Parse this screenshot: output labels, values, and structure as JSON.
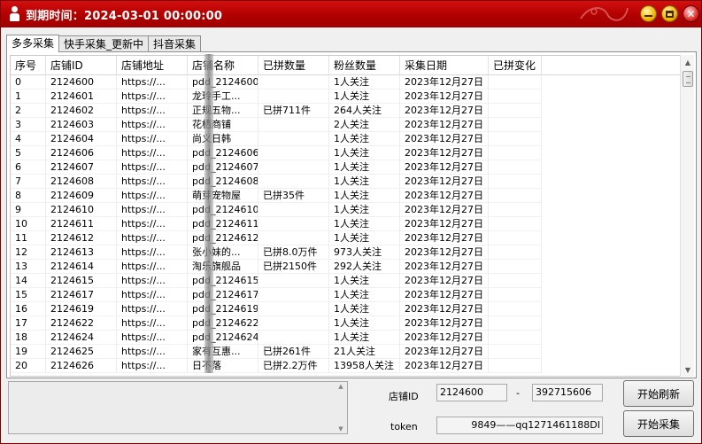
{
  "window": {
    "title": "到期时间：2024-03-01 00:00:00",
    "accent": "#b00000"
  },
  "tabs": [
    {
      "label": "多多采集",
      "active": true
    },
    {
      "label": "快手采集_更新中",
      "active": false
    },
    {
      "label": "抖音采集",
      "active": false
    }
  ],
  "table": {
    "columns": [
      "序号",
      "店铺ID",
      "店铺地址",
      "店铺名称",
      "已拼数量",
      "粉丝数量",
      "采集日期",
      "已拼变化"
    ],
    "rows": [
      [
        "0",
        "2124600",
        "https://...",
        "pdd_2124600",
        "",
        "1人关注",
        "2023年12月27日",
        ""
      ],
      [
        "1",
        "2124601",
        "https://...",
        "龙玲手工...",
        "",
        "1人关注",
        "2023年12月27日",
        ""
      ],
      [
        "2",
        "2124602",
        "https://...",
        "正规五物...",
        "已拼711件",
        "264人关注",
        "2023年12月27日",
        ""
      ],
      [
        "3",
        "2124603",
        "https://...",
        "花栖商铺",
        "",
        "2人关注",
        "2023年12月27日",
        ""
      ],
      [
        "4",
        "2124604",
        "https://...",
        "尚义日韩",
        "",
        "1人关注",
        "2023年12月27日",
        ""
      ],
      [
        "5",
        "2124606",
        "https://...",
        "pdd_2124606",
        "",
        "1人关注",
        "2023年12月27日",
        ""
      ],
      [
        "6",
        "2124607",
        "https://...",
        "pdd_2124607",
        "",
        "1人关注",
        "2023年12月27日",
        ""
      ],
      [
        "7",
        "2124608",
        "https://...",
        "pdd_2124608",
        "",
        "1人关注",
        "2023年12月27日",
        ""
      ],
      [
        "8",
        "2124609",
        "https://...",
        "萌芽宠物屋",
        "已拼35件",
        "1人关注",
        "2023年12月27日",
        ""
      ],
      [
        "9",
        "2124610",
        "https://...",
        "pdd_2124610",
        "",
        "1人关注",
        "2023年12月27日",
        ""
      ],
      [
        "10",
        "2124611",
        "https://...",
        "pdd_2124611",
        "",
        "1人关注",
        "2023年12月27日",
        ""
      ],
      [
        "11",
        "2124612",
        "https://...",
        "pdd_2124612",
        "",
        "1人关注",
        "2023年12月27日",
        ""
      ],
      [
        "12",
        "2124613",
        "https://...",
        "张小妹的...",
        "已拼8.0万件",
        "973人关注",
        "2023年12月27日",
        ""
      ],
      [
        "13",
        "2124614",
        "https://...",
        "淘乐旗舰品",
        "已拼2150件",
        "292人关注",
        "2023年12月27日",
        ""
      ],
      [
        "14",
        "2124615",
        "https://...",
        "pdd_2124615",
        "",
        "1人关注",
        "2023年12月27日",
        ""
      ],
      [
        "15",
        "2124617",
        "https://...",
        "pdd_2124617",
        "",
        "1人关注",
        "2023年12月27日",
        ""
      ],
      [
        "16",
        "2124619",
        "https://...",
        "pdd_2124619",
        "",
        "1人关注",
        "2023年12月27日",
        ""
      ],
      [
        "17",
        "2124622",
        "https://...",
        "pdd_2124622",
        "",
        "1人关注",
        "2023年12月27日",
        ""
      ],
      [
        "18",
        "2124624",
        "https://...",
        "pdd_2124624",
        "",
        "1人关注",
        "2023年12月27日",
        ""
      ],
      [
        "19",
        "2124625",
        "https://...",
        "家有互惠...",
        "已拼261件",
        "21人关注",
        "2023年12月27日",
        ""
      ],
      [
        "20",
        "2124626",
        "https://...",
        "日不落",
        "已拼2.2万件",
        "13958人关注",
        "2023年12月27日",
        ""
      ]
    ]
  },
  "controls": {
    "shop_id_label": "店铺ID",
    "shop_id_from": "2124600",
    "dash": "-",
    "shop_id_to": "392715606",
    "token_label": "token",
    "token_value": "9849——qq1271461188DI",
    "refresh_button": "开始刷新",
    "collect_button": "开始采集"
  }
}
